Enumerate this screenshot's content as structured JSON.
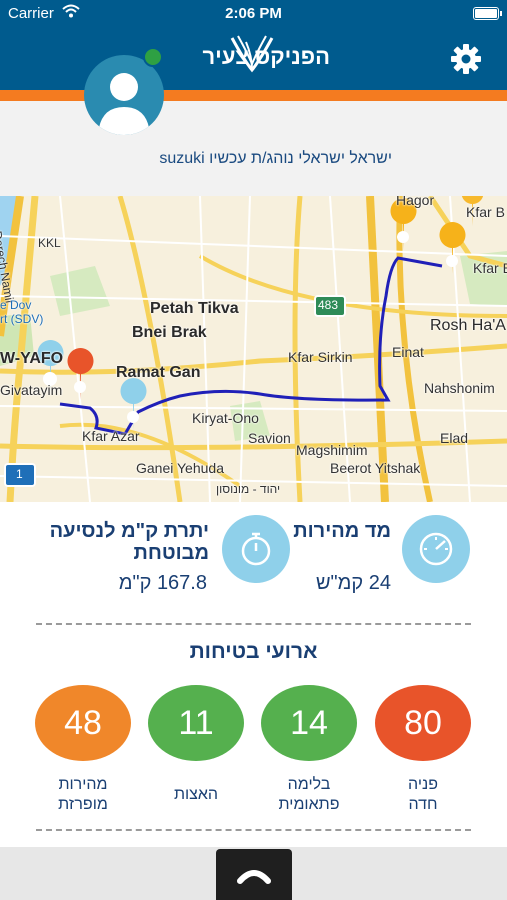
{
  "status_bar": {
    "carrier": "Carrier",
    "time": "2:06 PM"
  },
  "header": {
    "logo_text": "הפניקס צעיר",
    "settings_icon": "gear-icon",
    "accent": "#f47b20",
    "bar_color": "#005b8e"
  },
  "profile": {
    "driver_line": "ישראל ישראלי נוהג/ת עכשיו suzuki",
    "status": "online"
  },
  "map": {
    "labels": [
      "Petah Tikva",
      "Bnei Brak",
      "Ramat Gan",
      "Kfar Sirkin",
      "Kiryat-Ono",
      "Savion",
      "Ganei Yehuda",
      "Magshimim",
      "Beerot Yitshak",
      "Rosh Ha'A",
      "Nahshonim",
      "Einat",
      "Elad",
      "Kfar B",
      "Kfar Ba",
      "Hagor",
      "W-YAFO",
      "Givatayim",
      "Kfar Azar",
      "Derech Namir",
      "KKL",
      "e Dov",
      "rt (SDV)",
      "יהוד - מונוסון",
      "483",
      "1"
    ]
  },
  "stats": {
    "speed_title": "מד מהירות",
    "speed_value": "24 קמ\"ש",
    "km_title": "יתרת ק\"מ לנסיעה מבוטחת",
    "km_value": "167.8 ק\"מ"
  },
  "events": {
    "title": "ארועי בטיחות",
    "items": [
      {
        "label": "פניה חדה",
        "value": "80",
        "color": "#e8542a"
      },
      {
        "label": "בלימה פתאומית",
        "value": "14",
        "color": "#55b04e"
      },
      {
        "label": "האצות",
        "value": "11",
        "color": "#55b04e"
      },
      {
        "label": "מהירות מופרזת",
        "value": "48",
        "color": "#f0872a"
      }
    ]
  }
}
